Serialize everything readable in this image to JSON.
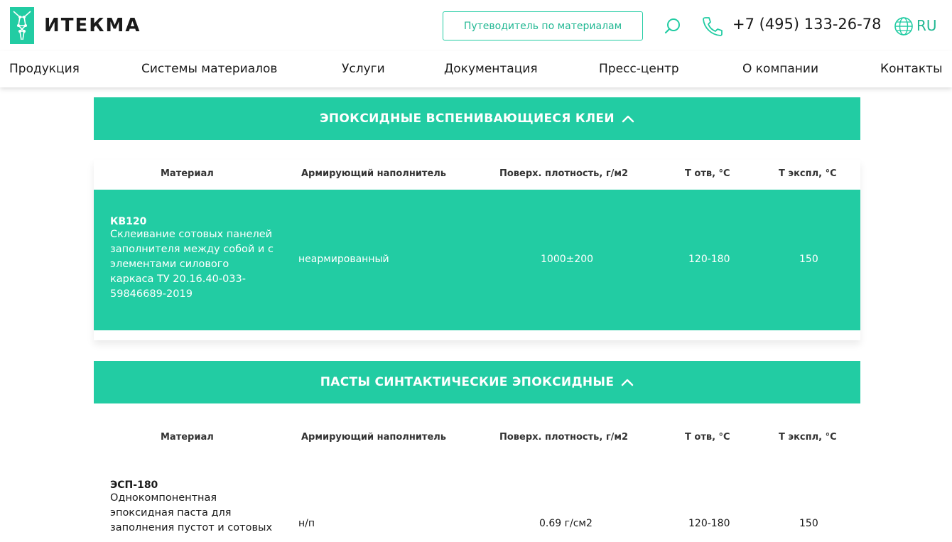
{
  "header": {
    "logo_text": "ИТЕКМА",
    "guide_button": "Путеводитель по материалам",
    "phone": "+7 (495) 133-26-78",
    "lang": "RU",
    "accent_color": "#22cca3"
  },
  "nav": {
    "items": [
      {
        "label": "Продукция"
      },
      {
        "label": "Системы материалов"
      },
      {
        "label": "Услуги"
      },
      {
        "label": "Документация"
      },
      {
        "label": "Пресс-центр"
      },
      {
        "label": "О компании"
      },
      {
        "label": "Контакты"
      }
    ]
  },
  "columns": {
    "material": "Материал",
    "filler": "Армирующий наполнитель",
    "density": "Поверх. плотность, г/м2",
    "t_cure": "Т отв, °С",
    "t_exp": "Т экспл, °С"
  },
  "sections": [
    {
      "title": "ЭПОКСИДНЫЕ ВСПЕНИВАЮЩИЕСЯ КЛЕИ",
      "rows": [
        {
          "name": "КВ120",
          "desc": [
            "Склеивание сотовых панелей",
            "заполнителя между собой и с",
            "элементами силового",
            "каркаса ТУ 20.16.40-033-",
            "59846689-2019"
          ],
          "filler": "неармированный",
          "density": "1000±200",
          "t_cure": "120-180",
          "t_exp": "150"
        }
      ]
    },
    {
      "title": "ПАСТЫ СИНТАКТИЧЕСКИЕ ЭПОКСИДНЫЕ",
      "rows": [
        {
          "name": "ЭСП-180",
          "desc": [
            "Однокомпонентная",
            "эпоксидная паста для",
            "заполнения пустот и сотовых"
          ],
          "filler": "н/п",
          "density": "0.69 г/см2",
          "t_cure": "120-180",
          "t_exp": "150"
        }
      ]
    }
  ]
}
